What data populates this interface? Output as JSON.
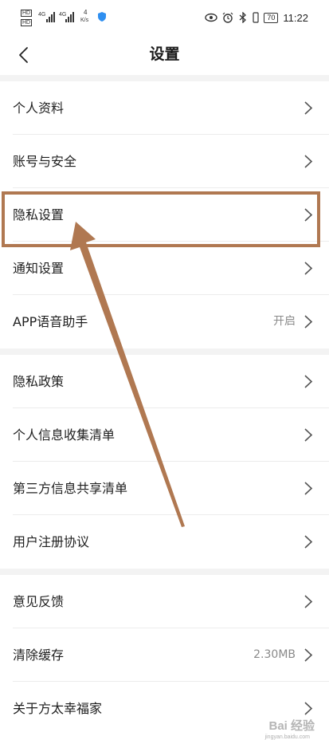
{
  "status_bar": {
    "net_label_1": "HD",
    "net_label_2": "HD",
    "signal_1": "4G",
    "signal_2": "4G",
    "speed_value": "4",
    "speed_unit": "K/s",
    "battery": "70",
    "time": "11:22"
  },
  "header": {
    "title": "设置"
  },
  "groups": [
    {
      "items": [
        {
          "label": "个人资料",
          "value": ""
        },
        {
          "label": "账号与安全",
          "value": ""
        },
        {
          "label": "隐私设置",
          "value": ""
        },
        {
          "label": "通知设置",
          "value": ""
        },
        {
          "label": "APP语音助手",
          "value": "开启"
        }
      ]
    },
    {
      "items": [
        {
          "label": "隐私政策",
          "value": ""
        },
        {
          "label": "个人信息收集清单",
          "value": ""
        },
        {
          "label": "第三方信息共享清单",
          "value": ""
        },
        {
          "label": "用户注册协议",
          "value": ""
        }
      ]
    },
    {
      "items": [
        {
          "label": "意见反馈",
          "value": ""
        },
        {
          "label": "清除缓存",
          "value": "2.30MB"
        },
        {
          "label": "关于方太幸福家",
          "value": ""
        }
      ]
    }
  ],
  "watermark": {
    "text": "Bai 经验",
    "sub": "jingyan.baidu.com"
  },
  "colors": {
    "annotation": "#b07851",
    "divider": "#ececec",
    "group_gap": "#f3f3f3"
  }
}
